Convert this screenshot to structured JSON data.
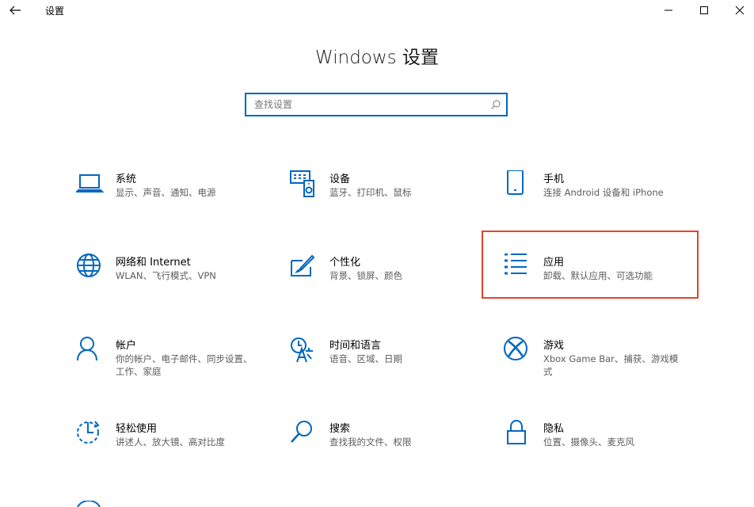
{
  "window": {
    "title": "设置"
  },
  "page": {
    "heading": "Windows 设置"
  },
  "search": {
    "placeholder": "查找设置"
  },
  "colors": {
    "accent": "#0067c0",
    "highlight": "#e8412c"
  },
  "tiles": [
    {
      "title": "系统",
      "desc": "显示、声音、通知、电源",
      "icon": "laptop-icon"
    },
    {
      "title": "设备",
      "desc": "蓝牙、打印机、鼠标",
      "icon": "keyboard-speaker-icon"
    },
    {
      "title": "手机",
      "desc": "连接 Android 设备和 iPhone",
      "icon": "phone-icon"
    },
    {
      "title": "网络和 Internet",
      "desc": "WLAN、飞行模式、VPN",
      "icon": "globe-icon"
    },
    {
      "title": "个性化",
      "desc": "背景、锁屏、颜色",
      "icon": "paint-icon"
    },
    {
      "title": "应用",
      "desc": "卸载、默认应用、可选功能",
      "icon": "app-list-icon"
    },
    {
      "title": "帐户",
      "desc": "你的帐户、电子邮件、同步设置、工作、家庭",
      "icon": "person-icon"
    },
    {
      "title": "时间和语言",
      "desc": "语音、区域、日期",
      "icon": "time-language-icon"
    },
    {
      "title": "游戏",
      "desc": "Xbox Game Bar、捕获、游戏模式",
      "icon": "xbox-icon"
    },
    {
      "title": "轻松使用",
      "desc": "讲述人、放大镜、高对比度",
      "icon": "ease-of-access-icon"
    },
    {
      "title": "搜索",
      "desc": "查找我的文件、权限",
      "icon": "magnifier-icon"
    },
    {
      "title": "隐私",
      "desc": "位置、摄像头、麦克风",
      "icon": "lock-icon"
    }
  ]
}
